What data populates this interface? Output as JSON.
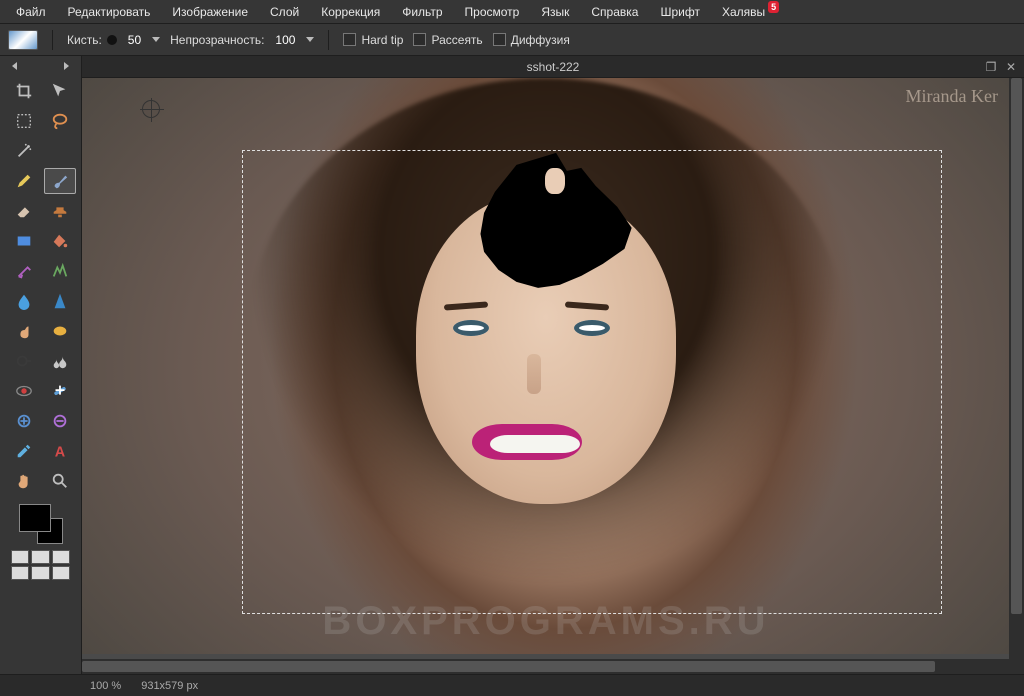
{
  "menu": {
    "file": "Файл",
    "edit": "Редактировать",
    "image": "Изображение",
    "layer": "Слой",
    "correction": "Коррекция",
    "filter": "Фильтр",
    "view": "Просмотр",
    "language": "Язык",
    "help": "Справка",
    "font": "Шрифт",
    "freebies": "Халявы",
    "freebies_badge": "5"
  },
  "options": {
    "brush_label": "Кисть:",
    "brush_size": "50",
    "opacity_label": "Непрозрачность:",
    "opacity_value": "100",
    "hard_tip": "Hard tip",
    "scatter": "Рассеять",
    "diffusion": "Диффузия"
  },
  "document": {
    "title": "sshot-222",
    "watermark_signature": "Miranda Ker",
    "watermark_site": "BOXPROGRAMS.RU"
  },
  "status": {
    "zoom": "100",
    "zoom_unit": "%",
    "dimensions": "931x579",
    "dim_unit": "px"
  },
  "tools": [
    {
      "id": "crop",
      "icon": "crop-icon",
      "color": "#bfbfbf"
    },
    {
      "id": "move",
      "icon": "move-icon",
      "color": "#bfbfbf"
    },
    {
      "id": "marquee",
      "icon": "marquee-icon",
      "color": "#bfbfbf"
    },
    {
      "id": "lasso",
      "icon": "lasso-icon",
      "color": "#e09050"
    },
    {
      "id": "wand",
      "icon": "wand-icon",
      "color": "#bfbfbf"
    },
    {
      "id": "",
      "icon": "",
      "color": ""
    },
    {
      "id": "pencil",
      "icon": "pencil-icon",
      "color": "#e7c95a"
    },
    {
      "id": "brush",
      "icon": "brush-icon",
      "color": "#8da7cc",
      "selected": true
    },
    {
      "id": "eraser",
      "icon": "eraser-icon",
      "color": "#d7c4b0"
    },
    {
      "id": "stamp",
      "icon": "clone-stamp-icon",
      "color": "#c57a3e"
    },
    {
      "id": "gradient",
      "icon": "gradient-icon",
      "color": "#4f8de0"
    },
    {
      "id": "bucket",
      "icon": "paint-bucket-icon",
      "color": "#d7795a"
    },
    {
      "id": "color-replace",
      "icon": "color-replace-icon",
      "color": "#b060c0"
    },
    {
      "id": "draw",
      "icon": "drawing-icon",
      "color": "#6aa860"
    },
    {
      "id": "blur",
      "icon": "blur-icon",
      "color": "#4aa0e0"
    },
    {
      "id": "sharpen",
      "icon": "sharpen-icon",
      "color": "#3a88c8"
    },
    {
      "id": "smudge",
      "icon": "smudge-icon",
      "color": "#e0a878"
    },
    {
      "id": "sponge",
      "icon": "sponge-icon",
      "color": "#e8b040"
    },
    {
      "id": "dodge",
      "icon": "dodge-icon",
      "color": "#3a3a3a"
    },
    {
      "id": "burn",
      "icon": "burn-icon",
      "color": "#c8c8c8"
    },
    {
      "id": "redeye",
      "icon": "redeye-icon",
      "color": "#d04040"
    },
    {
      "id": "spot-heal",
      "icon": "spot-heal-icon",
      "color": "#60a0d8"
    },
    {
      "id": "bloat",
      "icon": "bloat-icon",
      "color": "#5a90d0"
    },
    {
      "id": "pinch",
      "icon": "pinch-icon",
      "color": "#b070d8"
    },
    {
      "id": "eyedrop",
      "icon": "eyedropper-icon",
      "color": "#5fb0e0"
    },
    {
      "id": "type",
      "icon": "type-icon",
      "color": "#d64a4a"
    },
    {
      "id": "hand",
      "icon": "hand-icon",
      "color": "#e0a878"
    },
    {
      "id": "zoom",
      "icon": "zoom-icon",
      "color": "#bfbfbf"
    }
  ],
  "colors": {
    "foreground": "#000000",
    "background": "#000000"
  }
}
